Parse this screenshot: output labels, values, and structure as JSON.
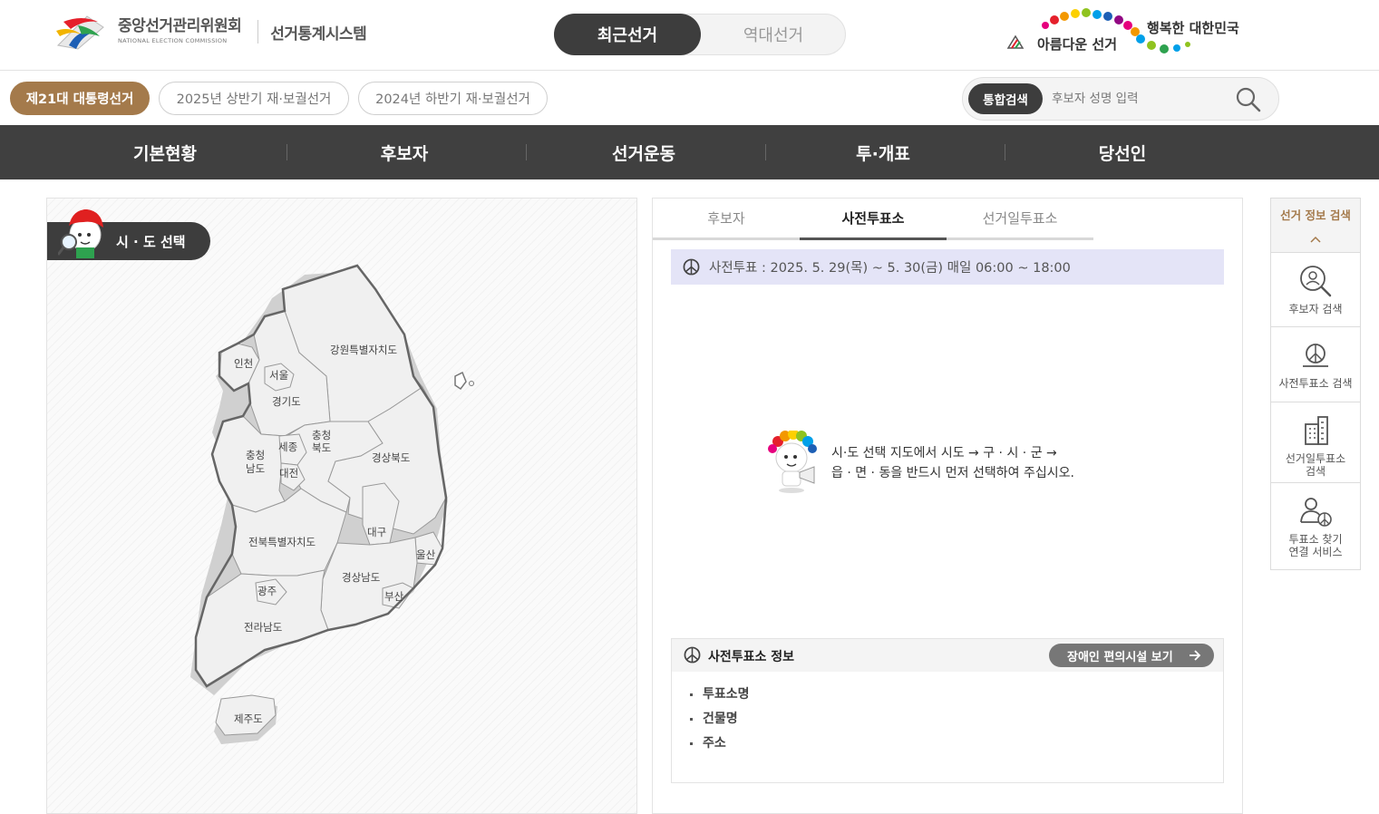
{
  "header": {
    "org_name": "중앙선거관리위원회",
    "org_name_en": "NATIONAL ELECTION COMMISSION",
    "system_name": "선거통계시스템",
    "toggle": {
      "recent": "최근선거",
      "past": "역대선거",
      "selected": "recent"
    },
    "slogan_left": "아름다운 선거",
    "slogan_right": "행복한 대한민국"
  },
  "election_tabs": [
    {
      "label": "제21대 대통령선거",
      "active": true
    },
    {
      "label": "2025년 상반기 재·보궐선거",
      "active": false
    },
    {
      "label": "2024년 하반기 재·보궐선거",
      "active": false
    }
  ],
  "search": {
    "tag": "통합검색",
    "placeholder": "후보자 성명 입력"
  },
  "nav": [
    "기본현황",
    "후보자",
    "선거운동",
    "투·개표",
    "당선인"
  ],
  "map_panel": {
    "title": "시 · 도 선택",
    "regions": {
      "incheon": "인천",
      "seoul": "서울",
      "gyeonggi": "경기도",
      "gangwon": "강원특별자치도",
      "chungbuk_1": "충청",
      "chungbuk_2": "북도",
      "chungnam_1": "충청",
      "chungnam_2": "남도",
      "sejong": "세종",
      "daejeon": "대전",
      "gyeongbuk": "경상북도",
      "daegu": "대구",
      "jeonbuk": "전북특별자치도",
      "ulsan": "울산",
      "gyeongnam": "경상남도",
      "busan": "부산",
      "gwangju": "광주",
      "jeonnam": "전라남도",
      "jeju": "제주도"
    }
  },
  "info_panel": {
    "tabs": [
      {
        "label": "후보자",
        "active": false
      },
      {
        "label": "사전투표소",
        "active": true
      },
      {
        "label": "선거일투표소",
        "active": false
      }
    ],
    "period": "사전투표 : 2025. 5. 29(목) ~ 5. 30(금) 매일 06:00 ~ 18:00",
    "guide_line1": "시·도 선택 지도에서 시도 → 구 · 시 · 군 →",
    "guide_line2": "읍 · 면 · 동을 반드시 먼저 선택하여 주십시오.",
    "early_info": {
      "title": "사전투표소 정보",
      "accessibility_button": "장애인 편의시설 보기",
      "fields": [
        "투표소명",
        "건물명",
        "주소"
      ]
    }
  },
  "quick_menu": {
    "title": "선거 정보 검색",
    "items": [
      {
        "label": "후보자 검색",
        "icon": "candidate-search-icon"
      },
      {
        "label": "사전투표소 검색",
        "icon": "early-voting-search-icon"
      },
      {
        "label_1": "선거일투표소",
        "label_2": "검색",
        "icon": "building-icon"
      },
      {
        "label_1": "투표소 찾기",
        "label_2": "연결 서비스",
        "icon": "person-link-icon"
      }
    ]
  },
  "colors": {
    "brand_brown": "#a47a4b",
    "dark": "#404040",
    "period_bg": "#e4e4f7"
  }
}
